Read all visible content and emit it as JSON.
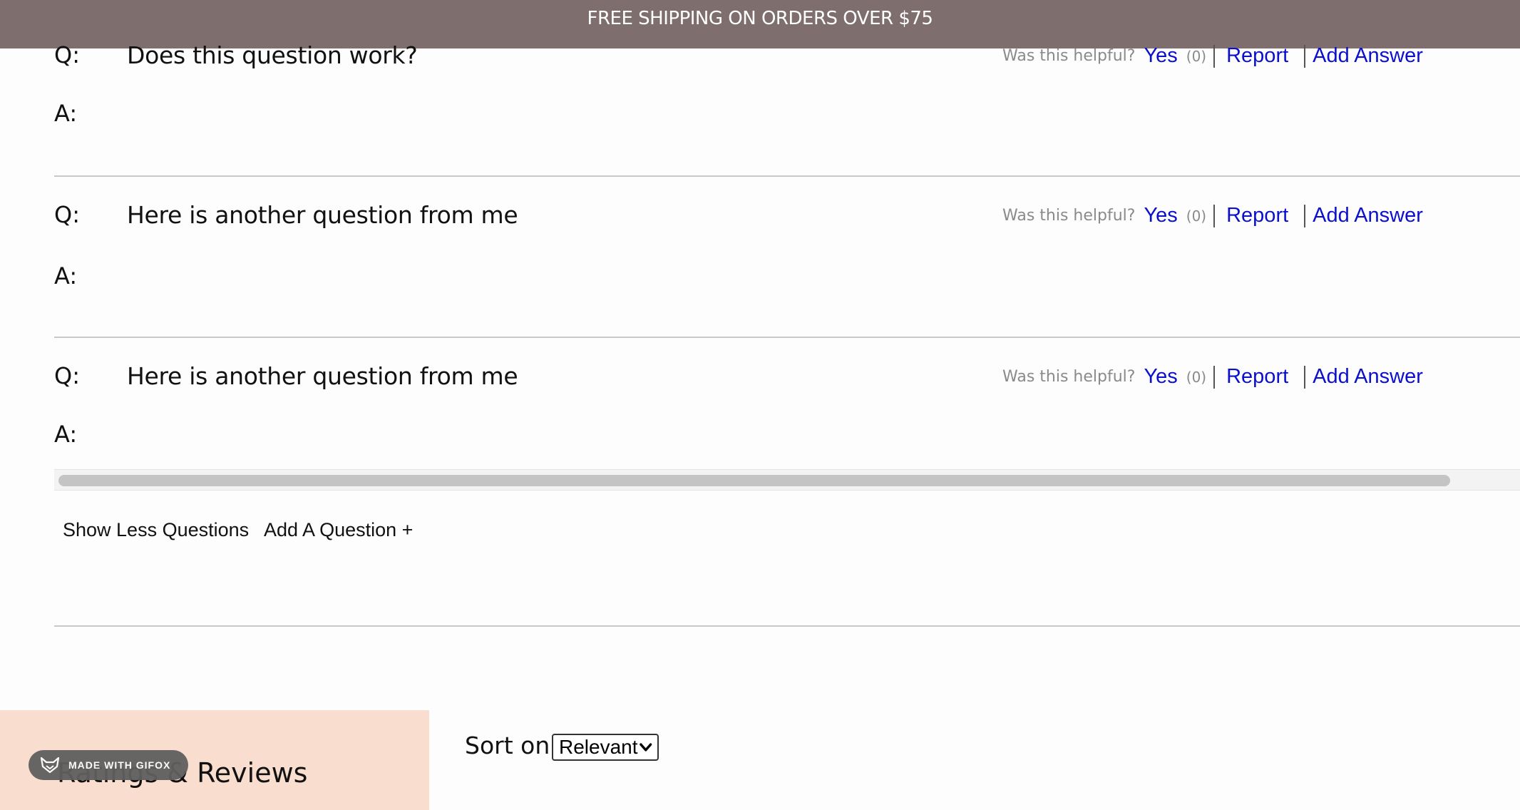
{
  "banner": {
    "text": "FREE SHIPPING ON ORDERS OVER $75"
  },
  "qa": {
    "q_prefix": "Q:",
    "a_prefix": "A:",
    "helpful_label": "Was this helpful?",
    "yes_label": "Yes",
    "report_label": "Report",
    "add_answer_label": "Add Answer",
    "questions": [
      {
        "text": "Does this question work?",
        "helpful_count": "(0)"
      },
      {
        "text": "Here is another question from me",
        "helpful_count": "(0)"
      },
      {
        "text": "Here is another question from me",
        "helpful_count": "(0)"
      }
    ]
  },
  "actions": {
    "show_less_label": "Show Less Questions",
    "add_question_label": "Add A Question +"
  },
  "ratings": {
    "title": "Ratings & Reviews",
    "sort_label": "Sort on:",
    "sort_selected": "Relevant"
  },
  "watermark": {
    "text": "MADE WITH GIFOX"
  },
  "colors": {
    "banner": "#7f6e6e",
    "link": "#0b10cc",
    "ratings_panel": "#f9ddcf"
  }
}
